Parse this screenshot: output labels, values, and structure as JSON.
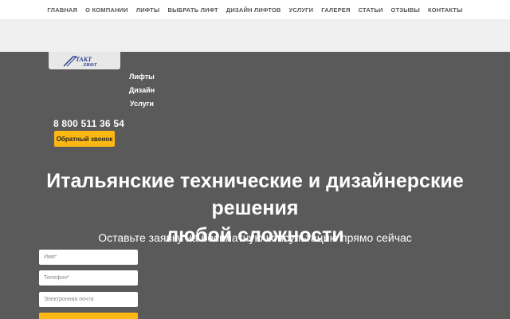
{
  "nav": {
    "items": [
      {
        "label": "ГЛАВНАЯ"
      },
      {
        "label": "О КОМПАНИИ"
      },
      {
        "label": "ЛИФТЫ"
      },
      {
        "label": "ВЫБРАТЬ ЛИФТ"
      },
      {
        "label": "ДИЗАЙН ЛИФТОВ"
      },
      {
        "label": "УСЛУГИ"
      },
      {
        "label": "ГАЛЕРЕЯ"
      },
      {
        "label": "СТАТЬИ"
      },
      {
        "label": "ОТЗЫВЫ"
      },
      {
        "label": "КОНТАКТЫ"
      }
    ]
  },
  "logo": {
    "text": "ТАКТ ЛИФТ"
  },
  "sidemenu": {
    "items": [
      {
        "label": "Лифты"
      },
      {
        "label": "Дизайн"
      },
      {
        "label": "Услуги"
      }
    ]
  },
  "contact": {
    "phone": "8 800 511 36 54",
    "callback_label": "Обратный звонок"
  },
  "hero": {
    "title_line1": "Итальянские технические и дизайнерские решения",
    "title_line2": "любой сложности",
    "subtitle": "Оставьте заявку на бесплатную консультацию прямо сейчас"
  },
  "form": {
    "name_placeholder": "Имя*",
    "phone_placeholder": "Телефон*",
    "email_placeholder": "Электронная почта"
  },
  "colors": {
    "accent": "#fdb813",
    "background": "#5a5a5a",
    "logo_blue": "#2a3f8f"
  },
  "icons": {
    "logo": "takt-lift-logo"
  }
}
